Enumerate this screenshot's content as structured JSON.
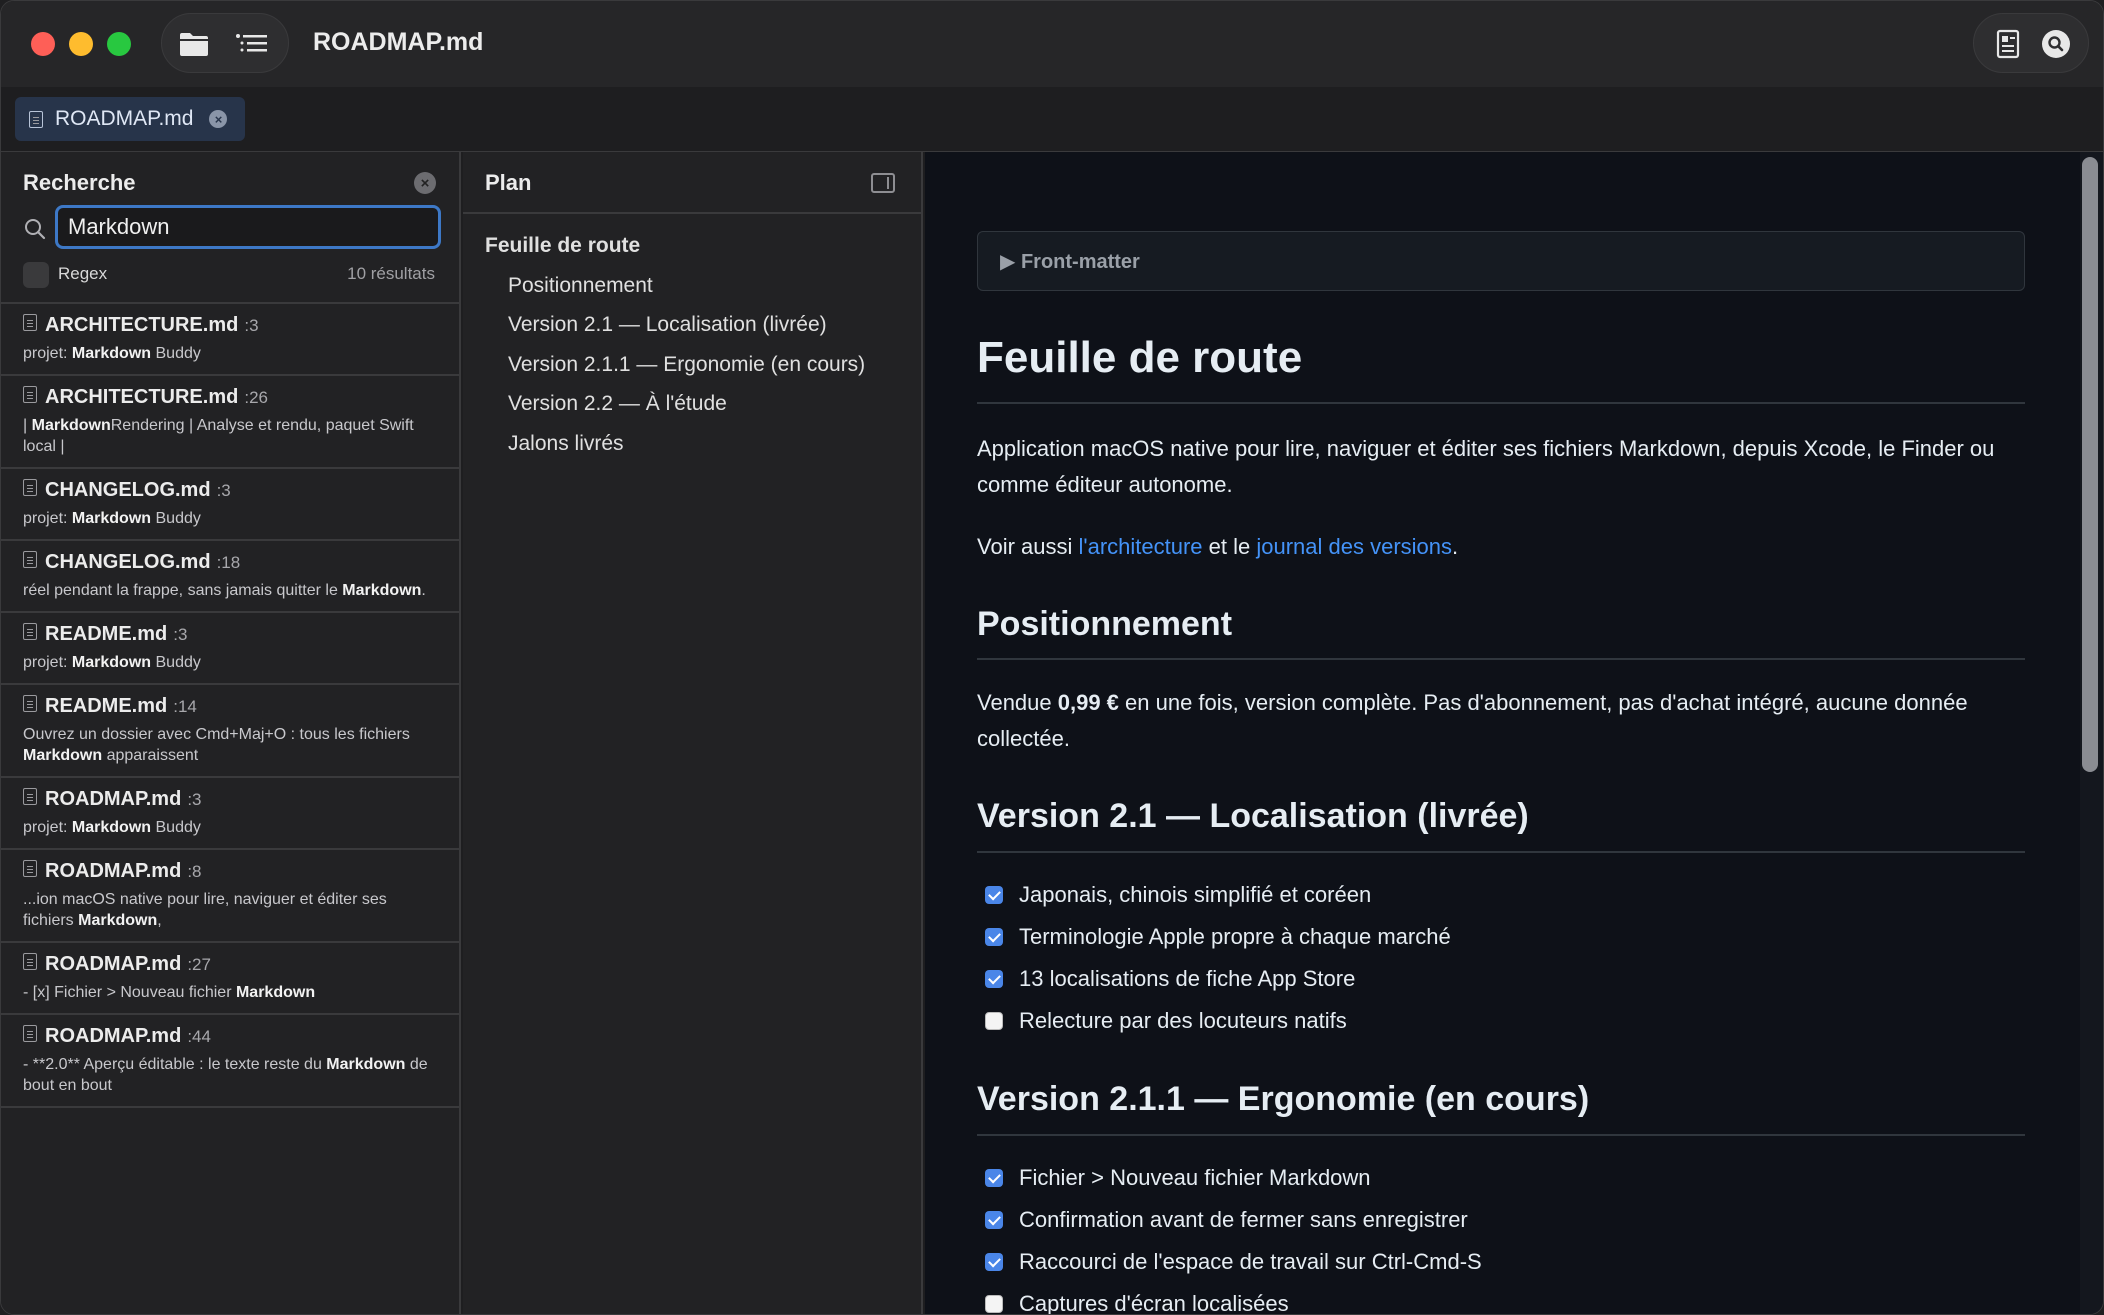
{
  "window": {
    "title": "ROADMAP.md"
  },
  "tab": {
    "label": "ROADMAP.md"
  },
  "search": {
    "title": "Recherche",
    "query": "Markdown",
    "regex_label": "Regex",
    "result_count": "10 résultats",
    "results": [
      {
        "file": "ARCHITECTURE.md",
        "line": ":3",
        "pre": "projet: ",
        "hit": "Markdown",
        "post": " Buddy"
      },
      {
        "file": "ARCHITECTURE.md",
        "line": ":26",
        "pre": "| ",
        "hit": "Markdown",
        "post": "Rendering | Analyse et rendu, paquet Swift local |"
      },
      {
        "file": "CHANGELOG.md",
        "line": ":3",
        "pre": "projet: ",
        "hit": "Markdown",
        "post": " Buddy"
      },
      {
        "file": "CHANGELOG.md",
        "line": ":18",
        "pre": "réel pendant la frappe, sans jamais quitter le ",
        "hit": "Markdown",
        "post": "."
      },
      {
        "file": "README.md",
        "line": ":3",
        "pre": "projet: ",
        "hit": "Markdown",
        "post": " Buddy"
      },
      {
        "file": "README.md",
        "line": ":14",
        "pre": "Ouvrez un dossier avec Cmd+Maj+O : tous les fichiers ",
        "hit": "Markdown",
        "post": " apparaissent"
      },
      {
        "file": "ROADMAP.md",
        "line": ":3",
        "pre": "projet: ",
        "hit": "Markdown",
        "post": " Buddy"
      },
      {
        "file": "ROADMAP.md",
        "line": ":8",
        "pre": "...ion macOS native pour lire, naviguer et éditer ses fichiers ",
        "hit": "Markdown",
        "post": ","
      },
      {
        "file": "ROADMAP.md",
        "line": ":27",
        "pre": "- [x] Fichier > Nouveau fichier ",
        "hit": "Markdown",
        "post": ""
      },
      {
        "file": "ROADMAP.md",
        "line": ":44",
        "pre": "- **2.0** Aperçu éditable : le texte reste du ",
        "hit": "Markdown",
        "post": " de bout en bout"
      }
    ]
  },
  "plan": {
    "title": "Plan",
    "items": [
      {
        "label": "Feuille de route",
        "level": 1
      },
      {
        "label": "Positionnement",
        "level": 2
      },
      {
        "label": "Version 2.1 — Localisation (livrée)",
        "level": 2
      },
      {
        "label": "Version 2.1.1 — Ergonomie (en cours)",
        "level": 2
      },
      {
        "label": "Version 2.2 — À l'étude",
        "level": 2
      },
      {
        "label": "Jalons livrés",
        "level": 2
      }
    ]
  },
  "preview": {
    "frontmatter_label": "▶ Front-matter",
    "h1": "Feuille de route",
    "intro": "Application macOS native pour lire, naviguer et éditer ses fichiers Markdown, depuis Xcode, le Finder ou comme éditeur autonome.",
    "see_also_pre": "Voir aussi ",
    "see_also_link1": "l'architecture",
    "see_also_mid": " et le ",
    "see_also_link2": "journal des versions",
    "see_also_post": ".",
    "h2_positioning": "Positionnement",
    "pos_pre": "Vendue ",
    "pos_bold": "0,99 €",
    "pos_post": " en une fois, version complète. Pas d'abonnement, pas d'achat intégré, aucune donnée collectée.",
    "h2_v21": "Version 2.1 — Localisation (livrée)",
    "v21_tasks": [
      {
        "label": "Japonais, chinois simplifié et coréen",
        "done": true
      },
      {
        "label": "Terminologie Apple propre à chaque marché",
        "done": true
      },
      {
        "label": "13 localisations de fiche App Store",
        "done": true
      },
      {
        "label": "Relecture par des locuteurs natifs",
        "done": false
      }
    ],
    "h2_v211": "Version 2.1.1 — Ergonomie (en cours)",
    "v211_tasks": [
      {
        "label": "Fichier > Nouveau fichier Markdown",
        "done": true
      },
      {
        "label": "Confirmation avant de fermer sans enregistrer",
        "done": true
      },
      {
        "label": "Raccourci de l'espace de travail sur Ctrl-Cmd-S",
        "done": true
      },
      {
        "label": "Captures d'écran localisées",
        "done": false
      }
    ]
  }
}
